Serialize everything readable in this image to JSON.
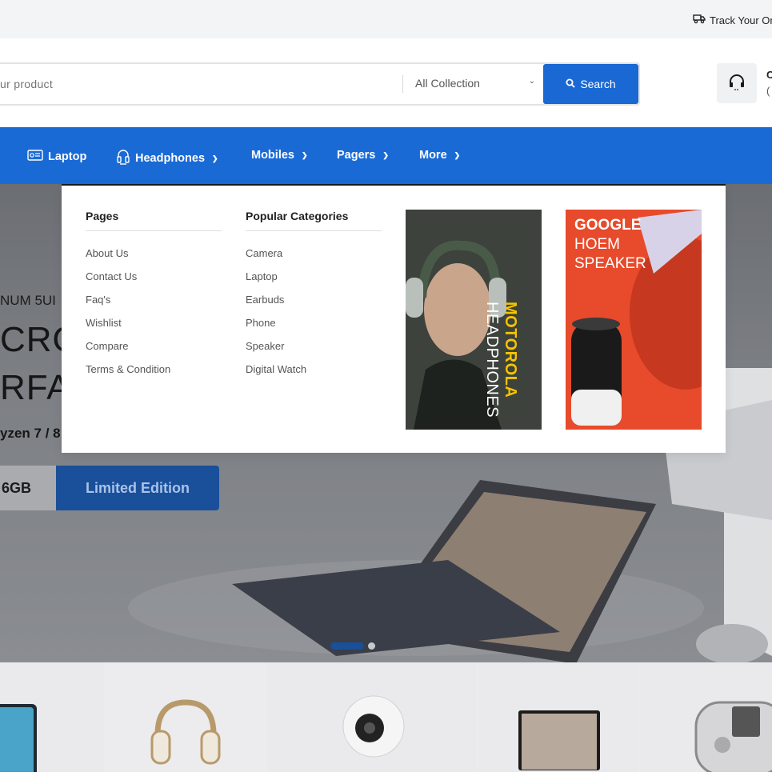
{
  "topbar": {
    "track_label": "Track Your Or"
  },
  "search": {
    "placeholder": "ur product",
    "collection": "All Collection",
    "button_label": "Search"
  },
  "support": {
    "line1": "C",
    "line2": "("
  },
  "nav": {
    "items": [
      {
        "label": "Laptop",
        "icon": "laptop-icon"
      },
      {
        "label": "Headphones",
        "icon": "headphones-icon"
      },
      {
        "label": "Mobiles"
      },
      {
        "label": "Pagers"
      },
      {
        "label": "More"
      }
    ]
  },
  "mega": {
    "pages_title": "Pages",
    "pages": [
      "About Us",
      "Contact Us",
      "Faq's",
      "Wishlist",
      "Compare",
      "Terms & Condition"
    ],
    "categories_title": "Popular Categories",
    "categories": [
      "Camera",
      "Laptop",
      "Earbuds",
      "Phone",
      "Speaker",
      "Digital Watch"
    ],
    "promo1": {
      "brand": "MOTOROLA",
      "product": "HEADPHONES"
    },
    "promo2": {
      "line1": "GOOGLE",
      "line2": "HOEM",
      "line3": "SPEAKER"
    }
  },
  "hero": {
    "kicker": "NUM 5UI",
    "title1": "CRO",
    "title2": "RFA",
    "spec": "yzen 7 / 8",
    "badge_storage": "6GB",
    "badge_edition": "Limited Edition"
  },
  "colors": {
    "primary": "#1a6ad6",
    "search_button": "#1a68d3",
    "edition_badge": "#1a4f9a",
    "promo_yellow": "#f5c400",
    "promo_orange": "#e8482a"
  }
}
